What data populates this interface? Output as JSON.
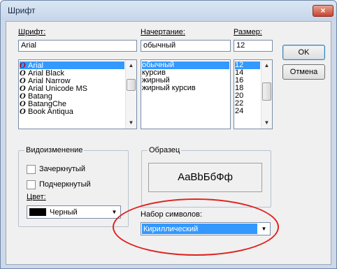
{
  "window": {
    "title": "Шрифт",
    "close_icon": "×"
  },
  "font": {
    "label": "Шрифт:",
    "value": "Arial",
    "items": [
      "Arial",
      "Arial Black",
      "Arial Narrow",
      "Arial Unicode MS",
      "Batang",
      "BatangChe",
      "Book Antiqua"
    ],
    "selected": "Arial"
  },
  "style": {
    "label": "Начертание:",
    "value": "обычный",
    "items": [
      "обычный",
      "курсив",
      "жирный",
      "жирный курсив"
    ],
    "selected": "обычный"
  },
  "size": {
    "label": "Размер:",
    "value": "12",
    "items": [
      "12",
      "14",
      "16",
      "18",
      "20",
      "22",
      "24"
    ],
    "selected": "12"
  },
  "buttons": {
    "ok": "OK",
    "cancel": "Отмена"
  },
  "effects": {
    "title": "Видоизменение",
    "strikeout": "Зачеркнутый",
    "underline": "Подчеркнутый",
    "color_label": "Цвет:",
    "color_value": "Черный",
    "color_swatch": "#000000"
  },
  "sample": {
    "title": "Образец",
    "text": "AaBbБбФф"
  },
  "charset": {
    "label": "Набор символов:",
    "value": "Кириллический"
  },
  "colors": {
    "selection": "#3399ff",
    "highlight": "#e02020"
  }
}
